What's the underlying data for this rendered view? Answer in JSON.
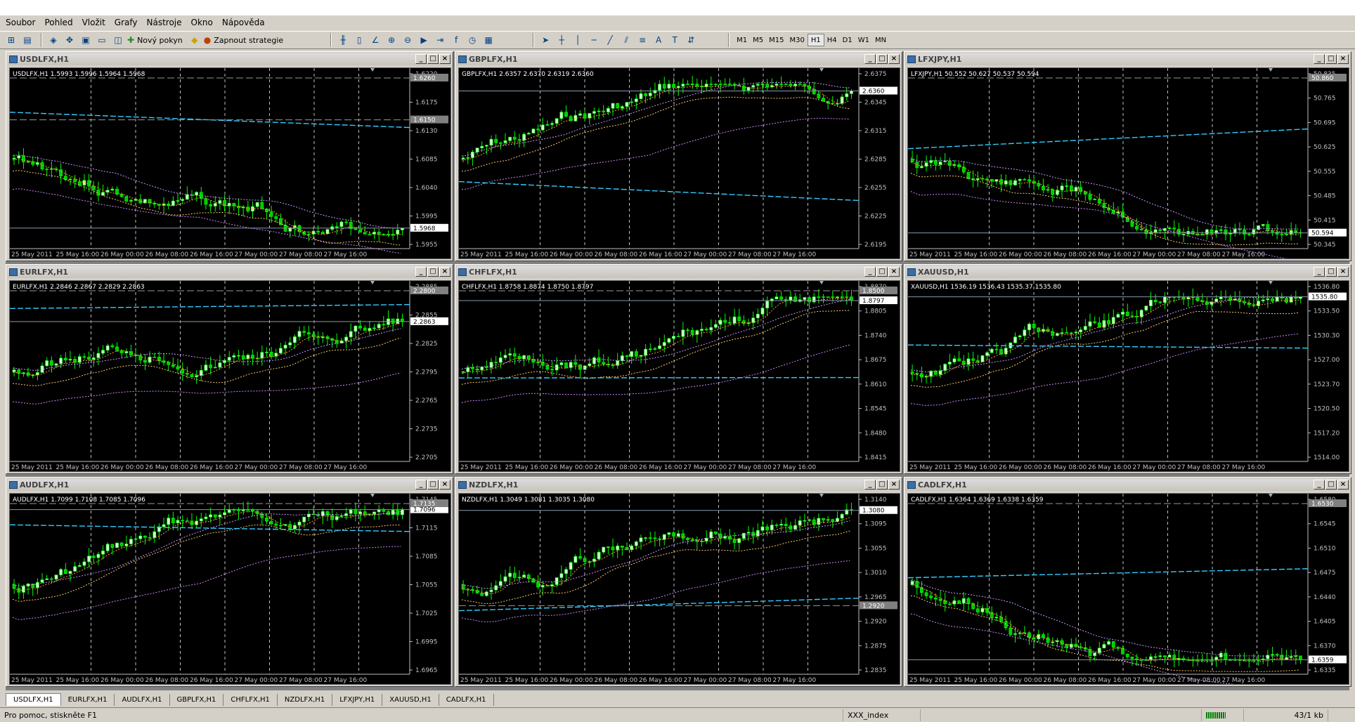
{
  "menu": [
    "Soubor",
    "Pohled",
    "Vložit",
    "Grafy",
    "Nástroje",
    "Okno",
    "Nápověda"
  ],
  "toolbar": {
    "new_order": "Nový pokyn",
    "autotrade": "Zapnout strategie",
    "timeframes": [
      "M1",
      "M5",
      "M15",
      "M30",
      "H1",
      "H4",
      "D1",
      "W1",
      "MN"
    ],
    "active_tf": "H1"
  },
  "xlabels": [
    "25 May 2011",
    "25 May 16:00",
    "26 May 00:00",
    "26 May 08:00",
    "26 May 16:00",
    "27 May 00:00",
    "27 May 08:00",
    "27 May 16:00"
  ],
  "charts": [
    {
      "title": "USDLFX,H1",
      "info": "USDLFX,H1  1.5993 1.5996 1.5964 1.5968",
      "ticks": [
        "1.6220",
        "1.6175",
        "1.6130",
        "1.6085",
        "1.6040",
        "1.5995",
        "1.5955"
      ],
      "hl1": "1.6260",
      "hl2": "1.6150",
      "last": "1.5968",
      "start": 1.623,
      "trend": -0.03,
      "seed": 3
    },
    {
      "title": "GBPLFX,H1",
      "info": "GBPLFX,H1  2.6357 2.6370 2.6319 2.6360",
      "ticks": [
        "2.6375",
        "2.6345",
        "2.6315",
        "2.6285",
        "2.6255",
        "2.6225",
        "2.6195"
      ],
      "hl1": "",
      "hl2": "",
      "last": "2.6360",
      "start": 2.6215,
      "trend": 0.014,
      "seed": 7
    },
    {
      "title": "LFXJPY,H1",
      "info": "LFXJPY,H1  50.552 50.627 50.537 50.594",
      "ticks": [
        "50.835",
        "50.765",
        "50.695",
        "50.625",
        "50.555",
        "50.485",
        "50.415",
        "50.345"
      ],
      "hl1": "50.860",
      "hl2": "",
      "last": "50.594",
      "start": 50.62,
      "trend": -0.02,
      "seed": 11
    },
    {
      "title": "EURLFX,H1",
      "info": "EURLFX,H1  2.2846 2.2867 2.2829 2.2863",
      "ticks": [
        "2.2885",
        "2.2855",
        "2.2825",
        "2.2795",
        "2.2765",
        "2.2735",
        "2.2705"
      ],
      "hl1": "2.2800",
      "hl2": "",
      "last": "2.2863",
      "start": 2.28,
      "trend": 0.006,
      "seed": 5
    },
    {
      "title": "CHFLFX,H1",
      "info": "CHFLFX,H1  1.8758 1.8874 1.8750 1.8797",
      "ticks": [
        "1.8870",
        "1.8805",
        "1.8740",
        "1.8675",
        "1.8610",
        "1.8545",
        "1.8480",
        "1.8415"
      ],
      "hl1": "1.8500",
      "hl2": "",
      "last": "1.8797",
      "start": 1.843,
      "trend": 0.036,
      "seed": 9
    },
    {
      "title": "XAUUSD,H1",
      "info": "XAUUSD,H1  1536.19 1536.43 1535.37 1535.80",
      "ticks": [
        "1536.80",
        "1533.50",
        "1530.30",
        "1527.00",
        "1523.70",
        "1520.50",
        "1517.20",
        "1514.00"
      ],
      "hl1": "",
      "hl2": "",
      "last": "1535.80",
      "start": 1524.0,
      "trend": 10.0,
      "seed": 13
    },
    {
      "title": "AUDLFX,H1",
      "info": "AUDLFX,H1  1.7099 1.7108 1.7085 1.7096",
      "ticks": [
        "1.7145",
        "1.7115",
        "1.7085",
        "1.7055",
        "1.7025",
        "1.6995",
        "1.6965"
      ],
      "hl1": "1.7135",
      "hl2": "",
      "last": "1.7096",
      "start": 1.699,
      "trend": 0.011,
      "seed": 17
    },
    {
      "title": "NZDLFX,H1",
      "info": "NZDLFX,H1  1.3049 1.3081 1.3035 1.3080",
      "ticks": [
        "1.3140",
        "1.3095",
        "1.3055",
        "1.3010",
        "1.2965",
        "1.2920",
        "1.2875",
        "1.2835"
      ],
      "hl1": "1.2920",
      "hl2": "",
      "last": "1.3080",
      "start": 1.285,
      "trend": 0.023,
      "seed": 19
    },
    {
      "title": "CADLFX,H1",
      "info": "CADLFX,H1  1.6364 1.6369 1.6338 1.6359",
      "ticks": [
        "1.6580",
        "1.6545",
        "1.6510",
        "1.6475",
        "1.6440",
        "1.6405",
        "1.6370",
        "1.6335"
      ],
      "hl1": "1.6530",
      "hl2": "",
      "last": "1.6359",
      "start": 1.657,
      "trend": -0.021,
      "seed": 23
    }
  ],
  "tabs": [
    "USDLFX,H1",
    "EURLFX,H1",
    "AUDLFX,H1",
    "GBPLFX,H1",
    "CHFLFX,H1",
    "NZDLFX,H1",
    "LFXJPY,H1",
    "XAUUSD,H1",
    "CADLFX,H1"
  ],
  "status": {
    "help": "Pro pomoc, stiskněte F1",
    "profile": "XXX_index",
    "traffic": "43/1 kb"
  },
  "colors": {
    "bull": "#ccffcc",
    "bear": "#00cc00",
    "bg": "#000000",
    "grid": "#c0c0c0"
  }
}
